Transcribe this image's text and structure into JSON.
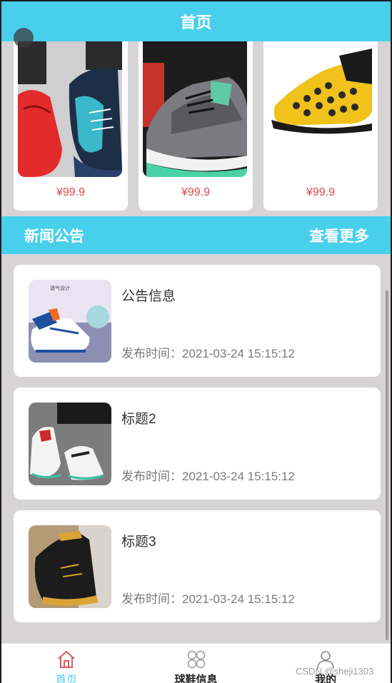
{
  "header": {
    "title": "首页"
  },
  "products": [
    {
      "price": "¥99.9",
      "image": "red-and-blue-basketball-shoes"
    },
    {
      "price": "¥99.9",
      "image": "grey-mint-sneaker"
    },
    {
      "price": "¥99.9",
      "image": "yellow-high-top-shoe"
    }
  ],
  "news": {
    "title": "新闻公告",
    "more": "查看更多",
    "items": [
      {
        "title": "公告信息",
        "time": "发布时间：2021-03-24 15:15:12",
        "image": "blue-white-sneaker-ad"
      },
      {
        "title": "标题2",
        "time": "发布时间：2021-03-24 15:15:12",
        "image": "white-high-top-sneakers"
      },
      {
        "title": "标题3",
        "time": "发布时间：2021-03-24 15:15:12",
        "image": "black-gold-high-top-shoe"
      }
    ]
  },
  "tabbar": {
    "items": [
      {
        "label": "首页",
        "icon": "home-icon",
        "active": true
      },
      {
        "label": "球鞋信息",
        "icon": "grid-icon",
        "active": false
      },
      {
        "label": "我的",
        "icon": "user-icon",
        "active": false
      }
    ]
  },
  "watermark": "CSDN @sheji1303",
  "colors": {
    "accent": "#48cfec",
    "price": "#e04949",
    "background": "#d7d4d5"
  }
}
